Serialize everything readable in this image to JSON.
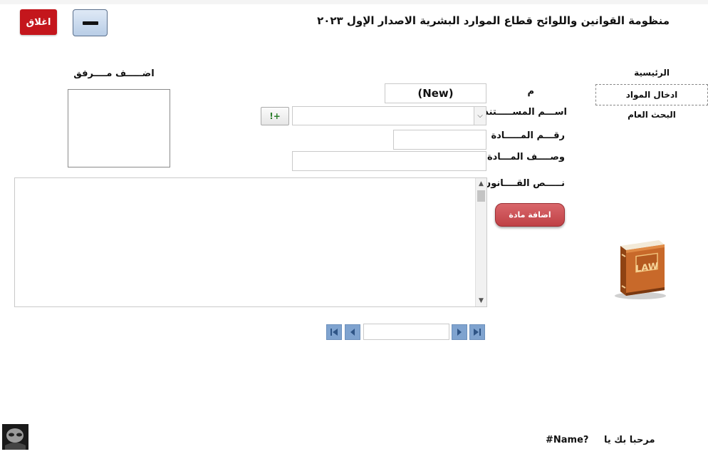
{
  "app": {
    "title": "منظومة القوانين واللوائح قطاع الموارد البشرية الاصدار الإول ٢٠٢٣",
    "close_label": "اغلاق"
  },
  "nav": {
    "items": [
      {
        "label": "الرئيسية",
        "active": false
      },
      {
        "label": "ادخال المواد",
        "active": true
      },
      {
        "label": "البحث العام",
        "active": false
      }
    ]
  },
  "form": {
    "id_label": "م",
    "id_value": "(New)",
    "doc_name_label": "اســـم المســـــتند",
    "article_number_label": "رقـــم المـــــادة",
    "article_desc_label": "وصــــف المـــادة",
    "law_text_label": "نـــــص القــــانون",
    "add_article_label": "اضافة مادة",
    "add_doc_button_label": "!+",
    "attachment_label": "اضـــــف مــــرفق"
  },
  "record_nav": {
    "current": ""
  },
  "footer": {
    "welcome_label": "مرحبا بك يا",
    "user_name": "#Name?"
  },
  "colors": {
    "close_button": "#c4161c",
    "add_article_button": "#c95257",
    "nav_buttons": "#7fa3cf"
  },
  "icons": {
    "minimize": "minimize-icon",
    "law_book": "law-book-icon",
    "first": "first-record-icon",
    "prev": "previous-record-icon",
    "next": "next-record-icon",
    "last": "last-record-icon"
  }
}
